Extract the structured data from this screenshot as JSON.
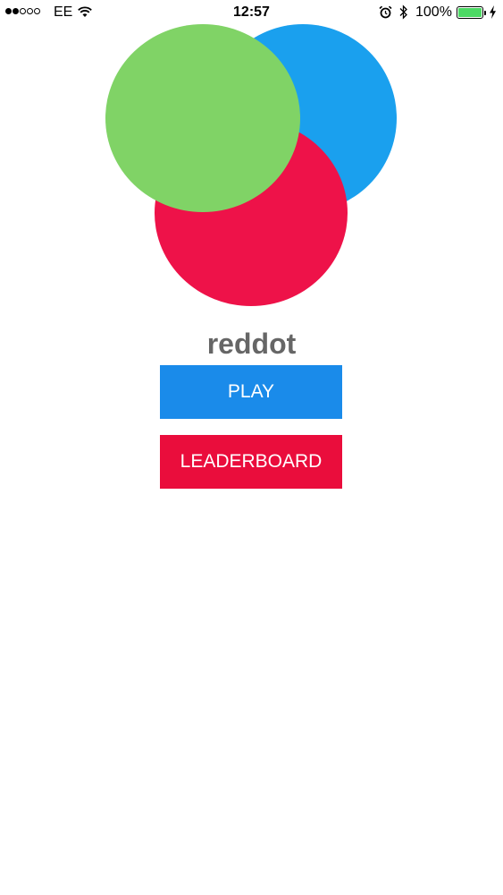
{
  "status_bar": {
    "signal_dots": [
      true,
      true,
      false,
      false,
      false
    ],
    "carrier": "EE",
    "time": "12:57",
    "battery_percent": "100%",
    "battery_level": 1.0,
    "icons": [
      "wifi-icon",
      "alarm-icon",
      "bluetooth-icon",
      "battery-icon",
      "charging-icon"
    ]
  },
  "logo": {
    "circles": [
      {
        "name": "blue-circle",
        "color": "#1aa0ee"
      },
      {
        "name": "red-circle",
        "color": "#ee1249"
      },
      {
        "name": "green-circle",
        "color": "#80d366"
      }
    ]
  },
  "app": {
    "title": "reddot"
  },
  "buttons": {
    "play_label": "PLAY",
    "play_color": "#1a8bea",
    "leaderboard_label": "LEADERBOARD",
    "leaderboard_color": "#ea0d3c"
  }
}
